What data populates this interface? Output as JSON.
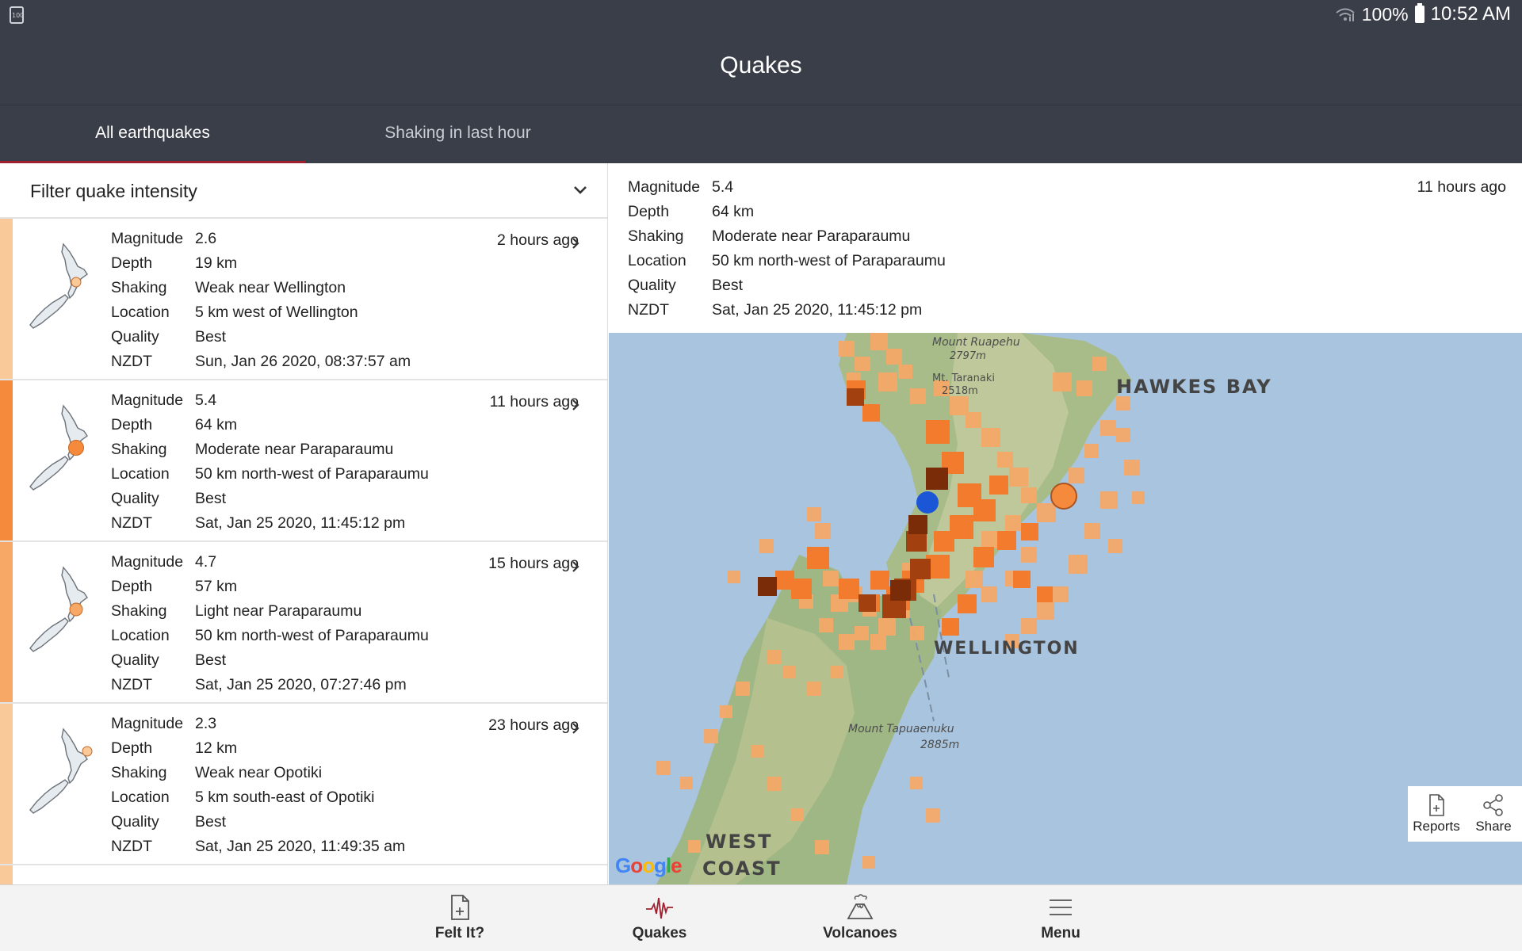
{
  "status": {
    "battery": "100%",
    "time": "10:52 AM",
    "left_badge": "100"
  },
  "app": {
    "title": "Quakes"
  },
  "tabs": [
    {
      "label": "All earthquakes",
      "active": true
    },
    {
      "label": "Shaking in last hour",
      "active": false
    }
  ],
  "filter": {
    "label": "Filter quake intensity"
  },
  "field_labels": {
    "magnitude": "Magnitude",
    "depth": "Depth",
    "shaking": "Shaking",
    "location": "Location",
    "quality": "Quality",
    "nzdt": "NZDT"
  },
  "quakes": [
    {
      "magnitude": "2.6",
      "depth": "19 km",
      "shaking": "Weak near Wellington",
      "location": "5 km west of Wellington",
      "quality": "Best",
      "nzdt": "Sun, Jan 26 2020, 08:37:57 am",
      "ago": "2 hours ago",
      "color": "#f9c99a"
    },
    {
      "magnitude": "5.4",
      "depth": "64 km",
      "shaking": "Moderate near Paraparaumu",
      "location": "50 km north-west of Paraparaumu",
      "quality": "Best",
      "nzdt": "Sat, Jan 25 2020, 11:45:12 pm",
      "ago": "11 hours ago",
      "color": "#f58a3c"
    },
    {
      "magnitude": "4.7",
      "depth": "57 km",
      "shaking": "Light near Paraparaumu",
      "location": "50 km north-west of Paraparaumu",
      "quality": "Best",
      "nzdt": "Sat, Jan 25 2020, 07:27:46 pm",
      "ago": "15 hours ago",
      "color": "#f7a766"
    },
    {
      "magnitude": "2.3",
      "depth": "12 km",
      "shaking": "Weak near Opotiki",
      "location": "5 km south-east of Opotiki",
      "quality": "Best",
      "nzdt": "Sat, Jan 25 2020, 11:49:35 am",
      "ago": "23 hours ago",
      "color": "#f9c99a"
    }
  ],
  "detail": {
    "magnitude": "5.4",
    "depth": "64 km",
    "shaking": "Moderate near Paraparaumu",
    "location": "50 km north-west of Paraparaumu",
    "quality": "Best",
    "nzdt": "Sat, Jan 25 2020, 11:45:12 pm",
    "ago": "11 hours ago"
  },
  "map": {
    "labels": {
      "hawkes": "HAWKES BAY",
      "mt_taranaki": "Mt. Taranaki",
      "mt_ruapehu": "Mount Ruapehu",
      "ruapehu_height": "2797m",
      "taranaki_height": "2518m",
      "wellington": "WELLINGTON",
      "tapuaenuku": "Mount Tapuaenuku",
      "tapuaenuku_height": "2885m",
      "west": "WEST",
      "coast": "COAST"
    },
    "google": [
      "G",
      "o",
      "o",
      "g",
      "l",
      "e"
    ],
    "actions": {
      "reports": "Reports",
      "share": "Share"
    }
  },
  "nav": [
    {
      "label": "Felt It?",
      "icon": "felt-it-icon"
    },
    {
      "label": "Quakes",
      "icon": "quakes-icon"
    },
    {
      "label": "Volcanoes",
      "icon": "volcano-icon"
    },
    {
      "label": "Menu",
      "icon": "menu-icon"
    }
  ]
}
